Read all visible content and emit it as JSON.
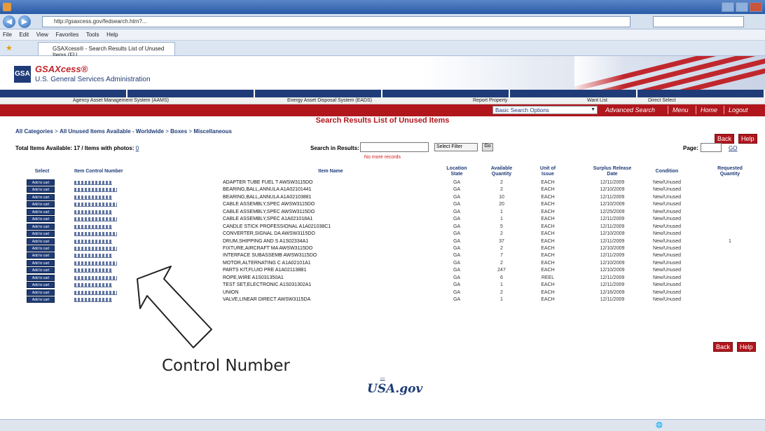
{
  "browser": {
    "address": "http://gsaxcess.gov/fedsearch.htm?...",
    "menu": [
      "File",
      "Edit",
      "View",
      "Favorites",
      "Tools",
      "Help"
    ],
    "tab": "GSAXcess® - Search Results List of Unused Items (FU..."
  },
  "site": {
    "logo_box": "GSA",
    "brand": "GSAXcess®",
    "agency": "U.S. General Services Administration",
    "nav1": [
      "",
      "",
      "",
      "",
      "",
      ""
    ],
    "nav2": {
      "aams": "Agency Asset Management System (AAMS)",
      "eads": "Energy Asset Disposal System (EADS)",
      "report": "Report Property",
      "want": "Want List",
      "direct": "Direct Select"
    },
    "search_option": "Basic Search Options",
    "links": [
      "Advanced Search",
      "Menu",
      "Home",
      "Logout"
    ]
  },
  "page": {
    "title": "Search Results List of Unused Items",
    "breadcrumb": [
      "All Categories",
      "All Unused Items Available - Worldwide",
      "Boxes",
      "Miscellaneous"
    ],
    "back": "Back",
    "help": "Help",
    "totals_label": "Total Items Available: 17 / Items with photos:",
    "search_in_results": "Search in Results:",
    "select_option": "Select Filter",
    "go": "Go",
    "no_records": "No more records",
    "page_label": "Page:",
    "go_to": "GO"
  },
  "table": {
    "headers": {
      "select": "Select",
      "icn": "Item Control Number",
      "item": "Item Name",
      "loc": "Location State",
      "qty": "Available Quantity",
      "uoi": "Unit of Issue",
      "date": "Surplus Release Date",
      "cond": "Condition",
      "req": "Requested Quantity"
    },
    "add_label": "Add to cart",
    "rows": [
      {
        "name": "ADAPTER TUBE FUEL T AWSW3115DO",
        "loc": "GA",
        "qty": "2",
        "uoi": "EACH",
        "date": "12/11/2009",
        "cond": "New/Unused",
        "req": ""
      },
      {
        "name": "BEARING,BALL,ANNULA A1A02101441",
        "loc": "GA",
        "qty": "2",
        "uoi": "EACH",
        "date": "12/10/2009",
        "cond": "New/Unused",
        "req": ""
      },
      {
        "name": "BEARING,BALL,ANNULA A1A02103881",
        "loc": "GA",
        "qty": "10",
        "uoi": "EACH",
        "date": "12/11/2009",
        "cond": "New/Unused",
        "req": ""
      },
      {
        "name": "CABLE ASSEMBLY,SPEC AWSW3115DO",
        "loc": "GA",
        "qty": "20",
        "uoi": "EACH",
        "date": "12/10/2009",
        "cond": "New/Unused",
        "req": ""
      },
      {
        "name": "CABLE ASSEMBLY,SPEC AWSW3115DO",
        "loc": "GA",
        "qty": "1",
        "uoi": "EACH",
        "date": "12/25/2009",
        "cond": "New/Unused",
        "req": ""
      },
      {
        "name": "CABLE ASSEMBLY,SPEC A1A021018A1",
        "loc": "GA",
        "qty": "1",
        "uoi": "EACH",
        "date": "12/11/2009",
        "cond": "New/Unused",
        "req": ""
      },
      {
        "name": "CANDLE STICK PROFESSIONAL A1A021038C1",
        "loc": "GA",
        "qty": "5",
        "uoi": "EACH",
        "date": "12/11/2009",
        "cond": "New/Unused",
        "req": ""
      },
      {
        "name": "CONVERTER,SIGNAL DA AWSW3115DO",
        "loc": "GA",
        "qty": "2",
        "uoi": "EACH",
        "date": "12/10/2009",
        "cond": "New/Unused",
        "req": ""
      },
      {
        "name": "DRUM,SHIPPING AND S A1S02334A1",
        "loc": "GA",
        "qty": "37",
        "uoi": "EACH",
        "date": "12/11/2009",
        "cond": "New/Unused",
        "req": "1"
      },
      {
        "name": "FIXTURE,AIRCRAFT MA AWSW3115DO",
        "loc": "GA",
        "qty": "2",
        "uoi": "EACH",
        "date": "12/10/2009",
        "cond": "New/Unused",
        "req": ""
      },
      {
        "name": "INTERFACE SUBASSEMB AWSW3115DO",
        "loc": "GA",
        "qty": "7",
        "uoi": "EACH",
        "date": "12/11/2009",
        "cond": "New/Unused",
        "req": ""
      },
      {
        "name": "MOTOR,ALTERNATING C A1A02101A1",
        "loc": "GA",
        "qty": "2",
        "uoi": "EACH",
        "date": "12/10/2009",
        "cond": "New/Unused",
        "req": ""
      },
      {
        "name": "PARTS KIT,FLUID PRE A1A021138B1",
        "loc": "GA",
        "qty": "247",
        "uoi": "EACH",
        "date": "12/10/2009",
        "cond": "New/Unused",
        "req": ""
      },
      {
        "name": "ROPE,WIRE A1S031350A1",
        "loc": "GA",
        "qty": "6",
        "uoi": "REEL",
        "date": "12/11/2009",
        "cond": "New/Unused",
        "req": ""
      },
      {
        "name": "TEST SET,ELECTRONIC A1S031302A1",
        "loc": "GA",
        "qty": "1",
        "uoi": "EACH",
        "date": "12/11/2009",
        "cond": "New/Unused",
        "req": ""
      },
      {
        "name": "UNION",
        "loc": "GA",
        "qty": "2",
        "uoi": "EACH",
        "date": "12/16/2009",
        "cond": "New/Unused",
        "req": ""
      },
      {
        "name": "VALVE,LINEAR DIRECT AWSW3115DA",
        "loc": "GA",
        "qty": "1",
        "uoi": "EACH",
        "date": "12/11/2009",
        "cond": "New/Unused",
        "req": ""
      }
    ]
  },
  "annotation": "Control Number",
  "footer": {
    "usagov": "USA.gov"
  },
  "colors": {
    "navy": "#1f3c78",
    "red": "#b1161d"
  }
}
